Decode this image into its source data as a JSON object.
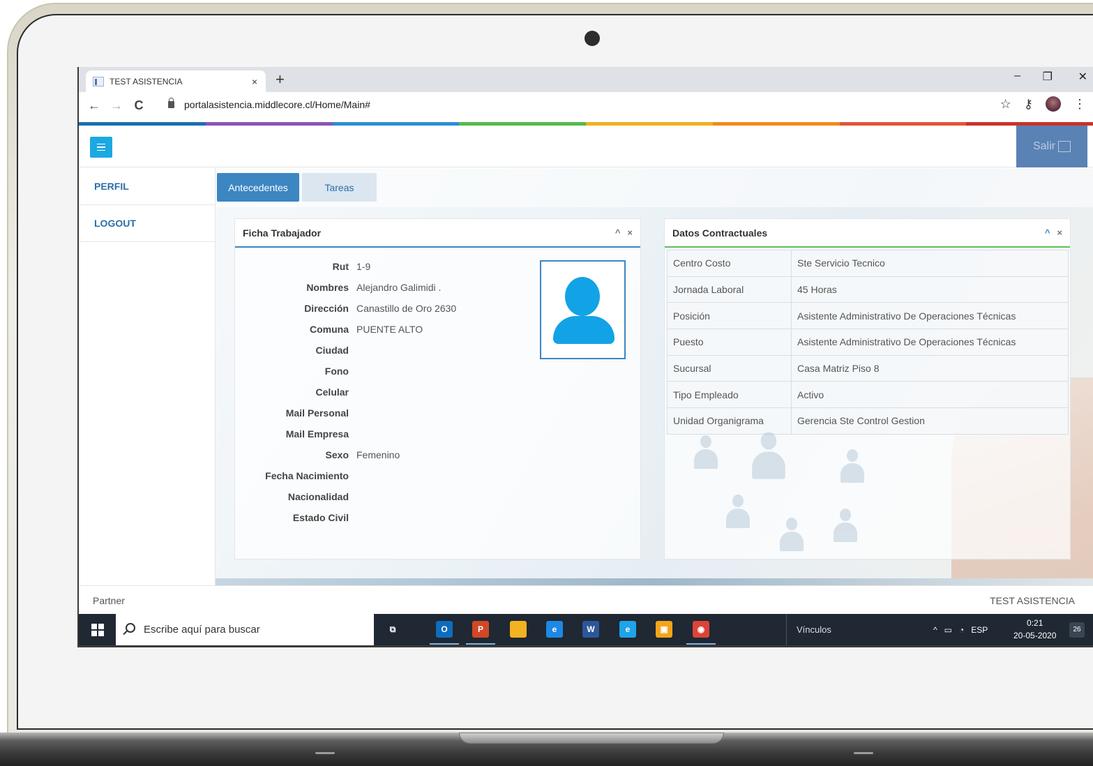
{
  "browser": {
    "tab_title": "TEST ASISTENCIA",
    "tab_close": "×",
    "new_tab": "+",
    "url": "portalasistencia.middlecore.cl/Home/Main#",
    "window_controls": {
      "minimize": "–",
      "restore": "❐",
      "close": "✕"
    },
    "nav": {
      "back": "←",
      "forward": "→",
      "reload": "C"
    },
    "right_icons": {
      "star": "☆",
      "key": "⚷",
      "menu": "⋮"
    },
    "colorbar": [
      "#1a6fb0",
      "#8a55b5",
      "#2b8fd6",
      "#57b94a",
      "#f0b11d",
      "#f08a1f",
      "#e25537",
      "#c9322a"
    ]
  },
  "app": {
    "exit_label": "Salir",
    "sidebar": [
      {
        "label": "PERFIL"
      },
      {
        "label": "LOGOUT"
      }
    ],
    "tabs": [
      {
        "label": "Antecedentes",
        "active": true
      },
      {
        "label": "Tareas",
        "active": false
      }
    ],
    "ficha": {
      "title": "Ficha Trabajador",
      "fields": [
        {
          "label": "Rut",
          "value": "1-9"
        },
        {
          "label": "Nombres",
          "value": "Alejandro Galimidi ."
        },
        {
          "label": "Dirección",
          "value": "Canastillo de Oro 2630"
        },
        {
          "label": "Comuna",
          "value": "PUENTE ALTO"
        },
        {
          "label": "Ciudad",
          "value": ""
        },
        {
          "label": "Fono",
          "value": ""
        },
        {
          "label": "Celular",
          "value": ""
        },
        {
          "label": "Mail Personal",
          "value": ""
        },
        {
          "label": "Mail Empresa",
          "value": ""
        },
        {
          "label": "Sexo",
          "value": "Femenino"
        },
        {
          "label": "Fecha Nacimiento",
          "value": ""
        },
        {
          "label": "Nacionalidad",
          "value": ""
        },
        {
          "label": "Estado Civil",
          "value": ""
        }
      ]
    },
    "contractual": {
      "title": "Datos Contractuales",
      "rows": [
        {
          "key": "Centro Costo",
          "value": "Ste Servicio Tecnico"
        },
        {
          "key": "Jornada Laboral",
          "value": "45 Horas"
        },
        {
          "key": "Posición",
          "value": "Asistente Administrativo De Operaciones Técnicas"
        },
        {
          "key": "Puesto",
          "value": "Asistente Administrativo De Operaciones Técnicas"
        },
        {
          "key": "Sucursal",
          "value": "Casa Matriz Piso 8"
        },
        {
          "key": "Tipo Empleado",
          "value": "Activo"
        },
        {
          "key": "Unidad Organigrama",
          "value": "Gerencia Ste Control Gestion"
        }
      ]
    },
    "panel_controls": {
      "collapse": "^",
      "close": "×"
    },
    "footer": {
      "left": "Partner",
      "right": "TEST ASISTENCIA"
    }
  },
  "taskbar": {
    "search_placeholder": "Escribe aquí para buscar",
    "links_label": "Vínculos",
    "language": "ESP",
    "time": "0:21",
    "date": "20-05-2020",
    "notifications": "26",
    "apps": [
      {
        "name": "task-view",
        "color": "#1f2833",
        "glyph": "⧉"
      },
      {
        "name": "outlook",
        "color": "#0f6cbd",
        "glyph": "O"
      },
      {
        "name": "powerpoint",
        "color": "#d24726",
        "glyph": "P"
      },
      {
        "name": "file-explorer",
        "color": "#f3b221",
        "glyph": ""
      },
      {
        "name": "edge",
        "color": "#1e88e5",
        "glyph": "e"
      },
      {
        "name": "word",
        "color": "#2b579a",
        "glyph": "W"
      },
      {
        "name": "internet-explorer",
        "color": "#1ea4e9",
        "glyph": "e"
      },
      {
        "name": "store",
        "color": "#f2a51a",
        "glyph": "▣"
      },
      {
        "name": "chrome",
        "color": "#db4437",
        "glyph": "◉"
      }
    ]
  }
}
